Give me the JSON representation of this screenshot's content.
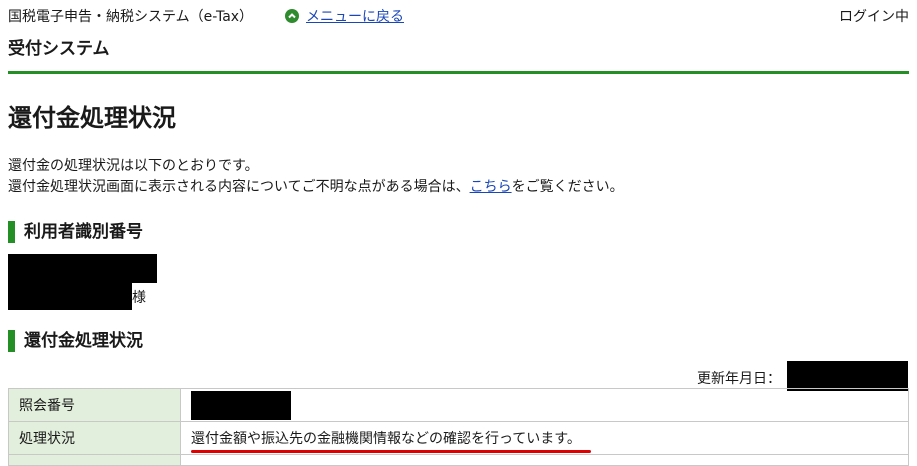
{
  "header": {
    "app_title": "国税電子申告・納税システム（e-Tax）",
    "menu_link": "メニューに戻る",
    "login_status": "ログイン中",
    "system_name": "受付システム"
  },
  "page": {
    "title": "還付金処理状況",
    "intro_line1": "還付金の処理状況は以下のとおりです。",
    "intro_line2_before": "還付金処理状況画面に表示される内容についてご不明な点がある場合は、",
    "intro_link": "こちら",
    "intro_line2_after": "をご覧ください。"
  },
  "user_section": {
    "heading": "利用者識別番号",
    "honorific": "様"
  },
  "status_section": {
    "heading": "還付金処理状況",
    "updated_label": "更新年月日：",
    "rows": [
      {
        "label": "照会番号",
        "value": ""
      },
      {
        "label": "処理状況",
        "value": "還付金額や振込先の金融機関情報などの確認を行っています。"
      }
    ]
  },
  "colors": {
    "accent_green": "#248f24",
    "link_blue": "#1a46b8",
    "table_head_bg": "#e3efdd",
    "highlight_red": "#e00000"
  }
}
